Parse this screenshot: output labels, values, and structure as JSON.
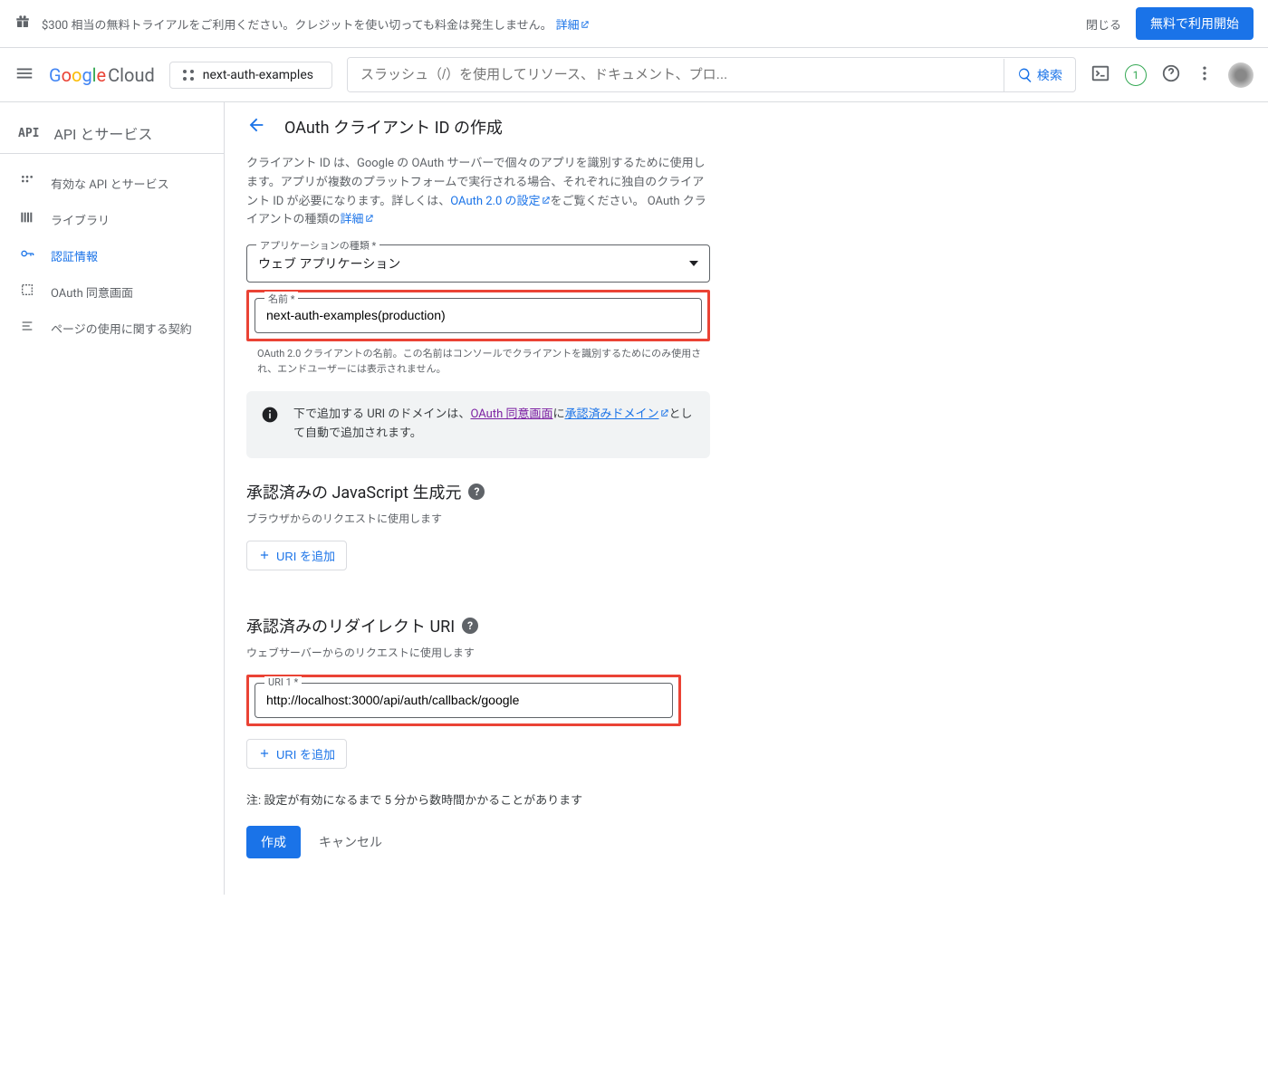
{
  "banner": {
    "text": "$300 相当の無料トライアルをご利用ください。クレジットを使い切っても料金は発生しません。",
    "link": "詳細",
    "close": "閉じる",
    "cta": "無料で利用開始"
  },
  "header": {
    "logo_cloud": "Cloud",
    "project": "next-auth-examples",
    "search_placeholder": "スラッシュ（/）を使用してリソース、ドキュメント、プロ...",
    "search_label": "検索",
    "badge": "1"
  },
  "sidebar": {
    "title": "API とサービス",
    "items": [
      {
        "icon": "dashboard",
        "label": "有効な API とサービス"
      },
      {
        "icon": "library",
        "label": "ライブラリ"
      },
      {
        "icon": "key",
        "label": "認証情報",
        "active": true
      },
      {
        "icon": "consent",
        "label": "OAuth 同意画面"
      },
      {
        "icon": "terms",
        "label": "ページの使用に関する契約"
      }
    ]
  },
  "page": {
    "title": "OAuth クライアント ID の作成",
    "desc_p1": "クライアント ID は、Google の OAuth サーバーで個々のアプリを識別するために使用します。アプリが複数のプラットフォームで実行される場合、それぞれに独自のクライアント ID が必要になります。詳しくは、",
    "desc_link1": "OAuth 2.0 の設定",
    "desc_p2": "をご覧ください。 OAuth クライアントの種類の",
    "desc_link2": "詳細"
  },
  "form": {
    "app_type_label": "アプリケーションの種類 *",
    "app_type_value": "ウェブ アプリケーション",
    "name_label": "名前 *",
    "name_value": "next-auth-examples(production)",
    "name_help": "OAuth 2.0 クライアントの名前。この名前はコンソールでクライアントを識別するためにのみ使用され、エンドユーザーには表示されません。"
  },
  "info_banner": {
    "text1": "下で追加する URI のドメインは、",
    "link1": "OAuth 同意画面",
    "text2": "に",
    "link2": "承認済みドメイン",
    "text3": "として自動で追加されます。"
  },
  "js_origins": {
    "title": "承認済みの JavaScript 生成元",
    "desc": "ブラウザからのリクエストに使用します",
    "add_btn": "URI を追加"
  },
  "redirect_uris": {
    "title": "承認済みのリダイレクト URI",
    "desc": "ウェブサーバーからのリクエストに使用します",
    "uri1_label": "URI 1 *",
    "uri1_value": "http://localhost:3000/api/auth/callback/google",
    "add_btn": "URI を追加"
  },
  "note": "注: 設定が有効になるまで 5 分から数時間かかることがあります",
  "actions": {
    "create": "作成",
    "cancel": "キャンセル"
  }
}
